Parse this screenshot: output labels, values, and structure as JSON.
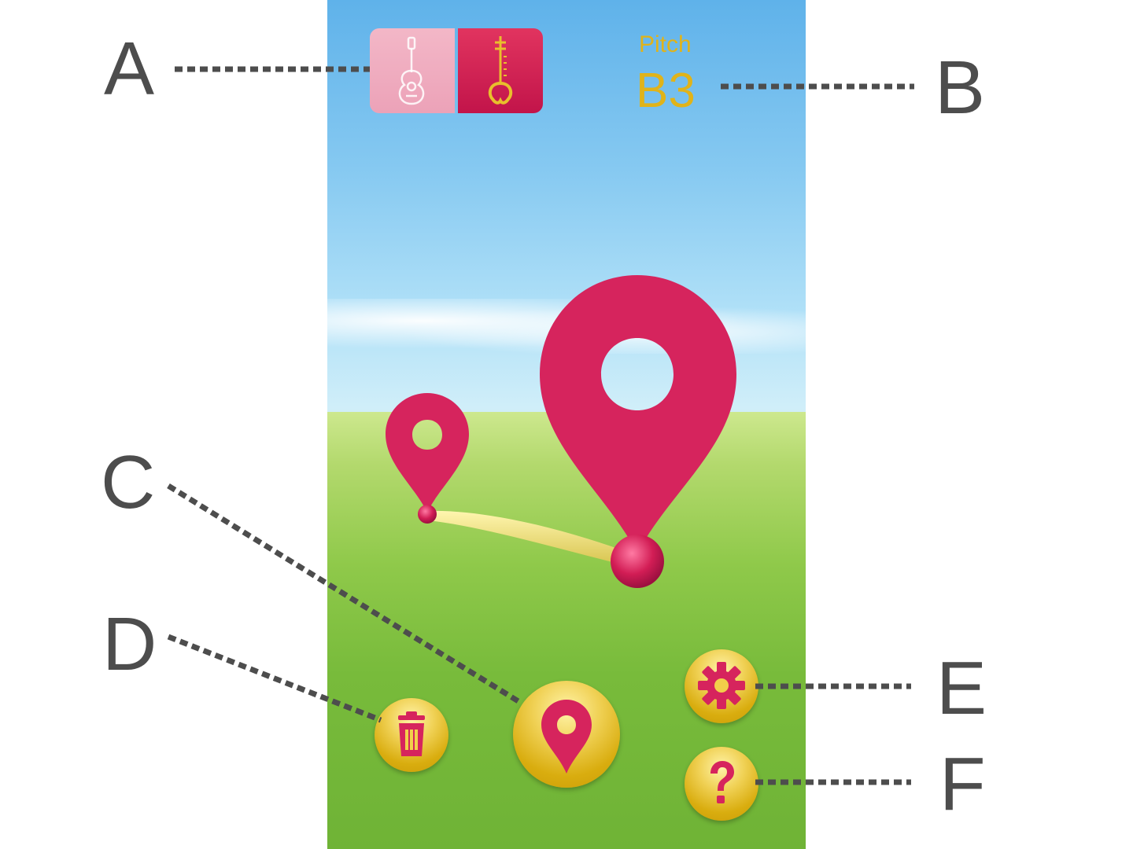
{
  "callouts": {
    "a": "A",
    "b": "B",
    "c": "C",
    "d": "D",
    "e": "E",
    "f": "F"
  },
  "pitch": {
    "label": "Pitch",
    "value": "B3"
  },
  "instruments": {
    "options": [
      "guitar-icon",
      "sitar-icon"
    ],
    "selected": "sitar-icon"
  },
  "buttons": {
    "add_pin": "map-pin-icon",
    "delete": "trash-icon",
    "settings": "gear-icon",
    "help": "question-icon"
  },
  "colors": {
    "accent": "#d6245d",
    "pitch_text": "#e0b319",
    "button_gold": "#e0b319",
    "callout": "#4d4d4d"
  }
}
